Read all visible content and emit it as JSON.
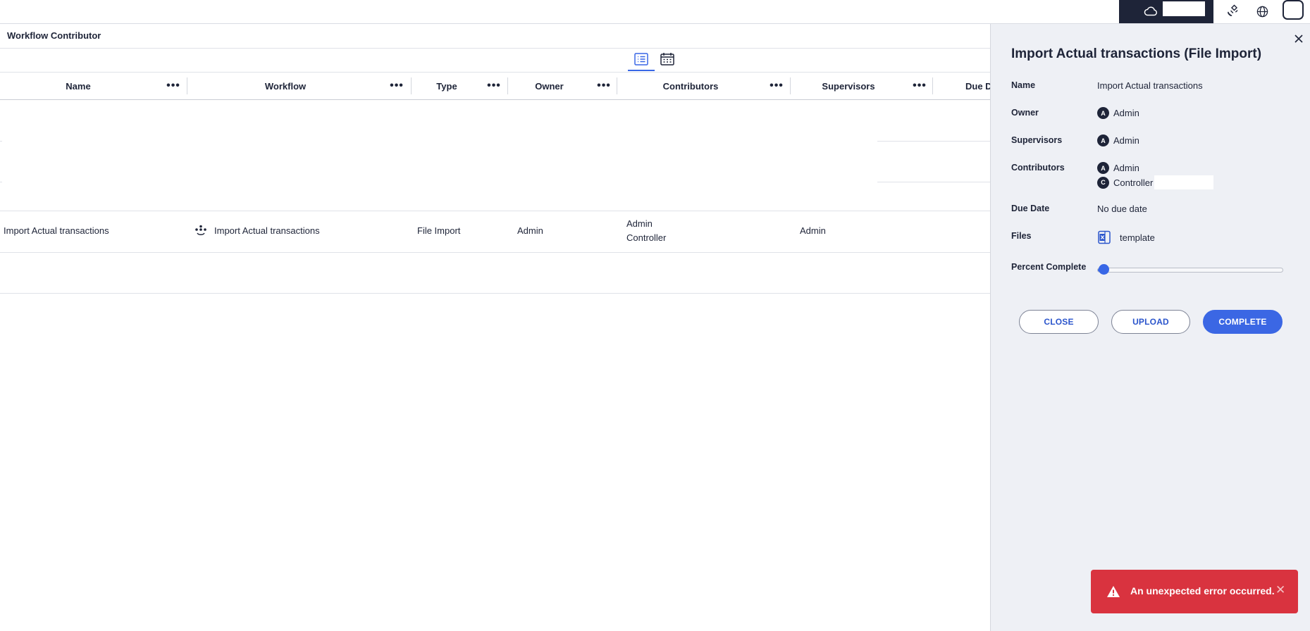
{
  "topbar": {
    "icons": [
      "cloud-icon",
      "satellite-icon",
      "globe-icon",
      "avatar"
    ]
  },
  "page": {
    "title": "Workflow Contributor"
  },
  "view_switch": {
    "options": [
      {
        "icon": "list-view-icon",
        "active": true
      },
      {
        "icon": "calendar-view-icon",
        "active": false
      }
    ]
  },
  "table": {
    "columns": [
      "Name",
      "Workflow",
      "Type",
      "Owner",
      "Contributors",
      "Supervisors",
      "Due D"
    ],
    "column_menu_glyph": "•••",
    "rows": [
      {
        "name": "Import Actual transactions",
        "workflow": "Import Actual transactions",
        "workflow_icon": "workflow-icon",
        "type": "File Import",
        "owner": "Admin",
        "contributors": [
          "Admin",
          "Controller"
        ],
        "supervisors": "Admin"
      }
    ]
  },
  "panel": {
    "title": "Import Actual transactions (File Import)",
    "fields": {
      "name": {
        "label": "Name",
        "value": "Import Actual transactions"
      },
      "owner": {
        "label": "Owner",
        "badge": "A",
        "value": "Admin"
      },
      "supervisors": {
        "label": "Supervisors",
        "badge": "A",
        "value": "Admin"
      },
      "contributors": {
        "label": "Contributors",
        "items": [
          {
            "badge": "A",
            "value": "Admin"
          },
          {
            "badge": "C",
            "value": "Controller"
          }
        ]
      },
      "due_date": {
        "label": "Due Date",
        "value": "No due date"
      },
      "files": {
        "label": "Files",
        "icon": "excel-file-icon",
        "value": "template"
      },
      "percent_complete": {
        "label": "Percent Complete",
        "value": 0
      }
    },
    "buttons": {
      "close": "CLOSE",
      "upload": "UPLOAD",
      "complete": "COMPLETE"
    },
    "accent": "#3b67e4"
  },
  "toast": {
    "message": "An unexpected error occurred.",
    "color": "#d9333f",
    "icon": "warning-icon",
    "close_glyph": "✕"
  }
}
